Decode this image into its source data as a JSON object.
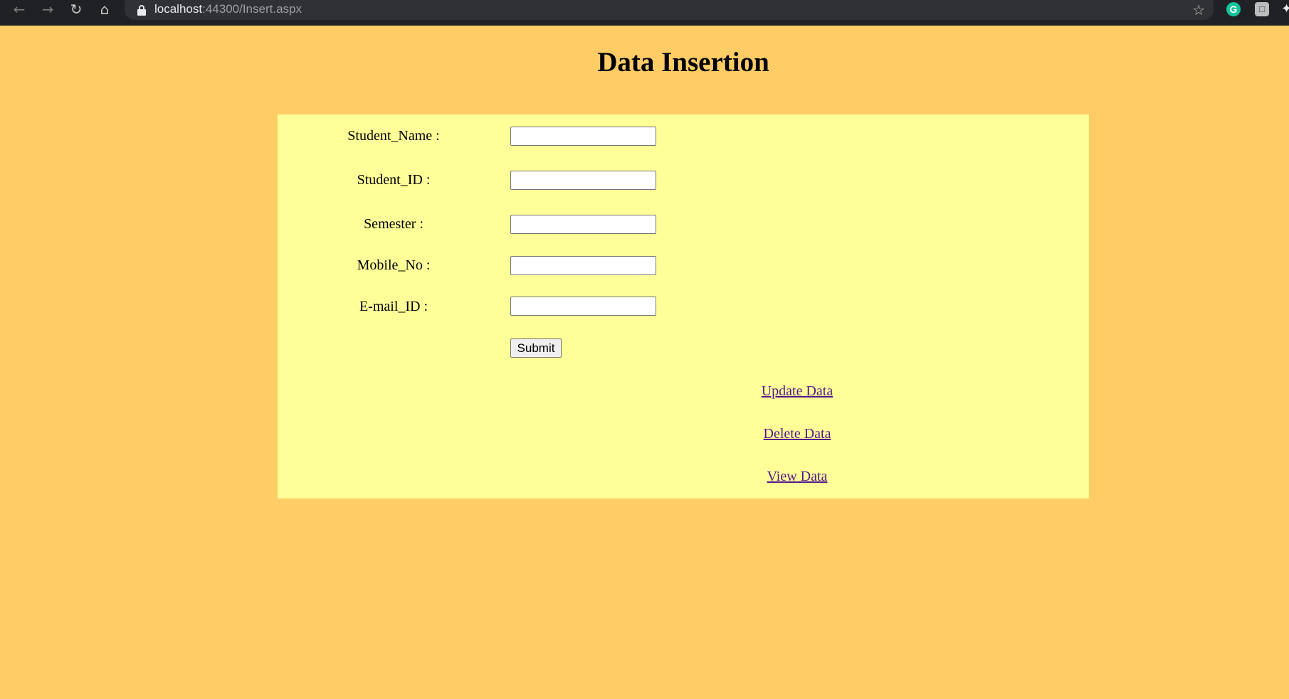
{
  "browser": {
    "url_host": "localhost",
    "url_path": ":44300/Insert.aspx",
    "icons": {
      "back": "arrow-left-icon",
      "forward": "arrow-right-icon",
      "reload": "reload-icon",
      "home": "home-icon",
      "lock": "lock-icon",
      "bookmark": "star-icon",
      "extension_grammarly": "grammarly-icon",
      "extension_other": "extension-icon",
      "extensions_menu": "puzzle-icon"
    },
    "grammarly_letter": "G"
  },
  "page": {
    "title": "Data Insertion",
    "background_color": "#ffcc66",
    "panel_color": "#ffff99"
  },
  "form": {
    "fields": [
      {
        "label": "Student_Name :",
        "value": "",
        "placeholder": ""
      },
      {
        "label": "Student_ID :",
        "value": "",
        "placeholder": ""
      },
      {
        "label": "Semester :",
        "value": "",
        "placeholder": ""
      },
      {
        "label": "Mobile_No :",
        "value": "",
        "placeholder": ""
      },
      {
        "label": "E-mail_ID :",
        "value": "",
        "placeholder": ""
      }
    ],
    "submit_label": "Submit"
  },
  "links": [
    {
      "label": "Update Data"
    },
    {
      "label": "Delete Data"
    },
    {
      "label": "View Data"
    }
  ]
}
